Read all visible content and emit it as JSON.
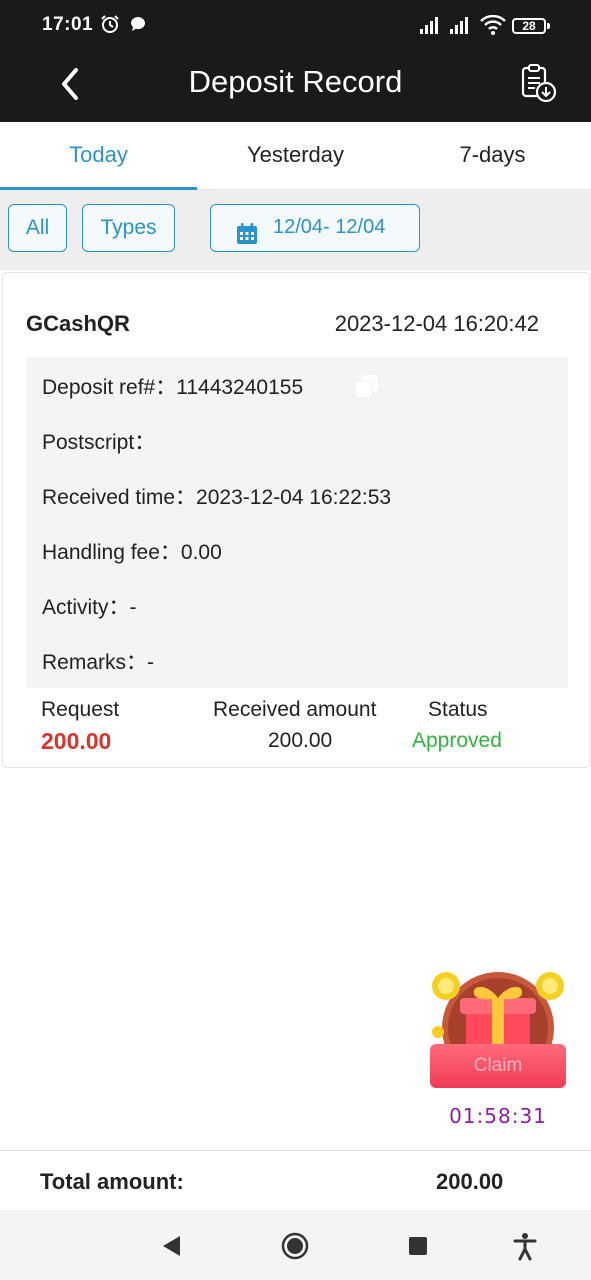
{
  "status_bar": {
    "time": "17:01",
    "battery": "28"
  },
  "header": {
    "title": "Deposit Record"
  },
  "tabs": [
    {
      "label": "Today",
      "active": true
    },
    {
      "label": "Yesterday",
      "active": false
    },
    {
      "label": "7-days",
      "active": false
    }
  ],
  "filters": {
    "all": "All",
    "types": "Types",
    "date_range": "12/04- 12/04"
  },
  "record": {
    "method": "GCashQR",
    "created": "2023-12-04 16:20:42",
    "deposit_ref": "Deposit ref#：11443240155",
    "postscript": "Postscript：",
    "received_time": "Received time：2023-12-04 16:22:53",
    "handling_fee": "Handling fee：0.00",
    "activity": "Activity：-",
    "remarks": "Remarks：-",
    "request_label": "Request",
    "request_value": "200.00",
    "received_label": "Received amount",
    "received_value": "200.00",
    "status_label": "Status",
    "status_value": "Approved"
  },
  "gift": {
    "claim_label": "Claim",
    "timer": "01:58:31"
  },
  "total": {
    "label": "Total amount:",
    "value": "200.00"
  },
  "colors": {
    "accent": "#2a93c9",
    "header_bg": "#1a1a1a",
    "request": "#d8352a",
    "approved": "#2fb53c",
    "timer": "#8a1fa6"
  }
}
